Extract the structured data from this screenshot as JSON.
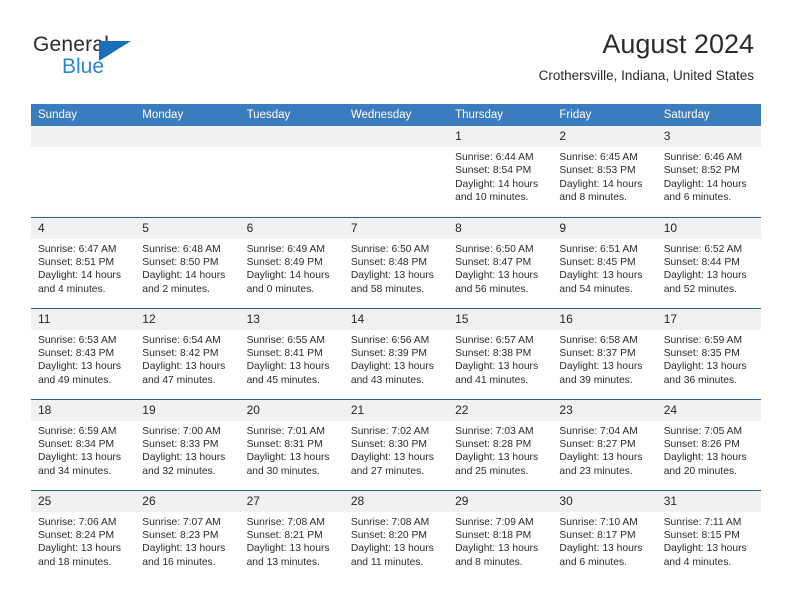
{
  "brand": {
    "name_line1": "General",
    "name_line2": "Blue",
    "triangle_color": "#1a70b8",
    "text_color": "#2b2b2b",
    "accent_color": "#2986cf"
  },
  "header": {
    "title": "August 2024",
    "location": "Crothersville, Indiana, United States"
  },
  "theme": {
    "header_bg": "#3b7cbe",
    "header_text": "#ffffff",
    "row_rule": "#2f5f93",
    "daynum_bg": "#f1f1f1",
    "body_text": "#2b2b2b"
  },
  "weekdays": [
    "Sunday",
    "Monday",
    "Tuesday",
    "Wednesday",
    "Thursday",
    "Friday",
    "Saturday"
  ],
  "labels": {
    "sunrise_prefix": "Sunrise:",
    "sunset_prefix": "Sunset:",
    "daylight_prefix": "Daylight:"
  },
  "weeks": [
    [
      {
        "day": "",
        "empty": true,
        "sunrise": "",
        "sunset": "",
        "daylight_line1": "",
        "daylight_line2": ""
      },
      {
        "day": "",
        "empty": true,
        "sunrise": "",
        "sunset": "",
        "daylight_line1": "",
        "daylight_line2": ""
      },
      {
        "day": "",
        "empty": true,
        "sunrise": "",
        "sunset": "",
        "daylight_line1": "",
        "daylight_line2": ""
      },
      {
        "day": "",
        "empty": true,
        "sunrise": "",
        "sunset": "",
        "daylight_line1": "",
        "daylight_line2": ""
      },
      {
        "day": "1",
        "empty": false,
        "sunrise": "Sunrise: 6:44 AM",
        "sunset": "Sunset: 8:54 PM",
        "daylight_line1": "Daylight: 14 hours",
        "daylight_line2": "and 10 minutes."
      },
      {
        "day": "2",
        "empty": false,
        "sunrise": "Sunrise: 6:45 AM",
        "sunset": "Sunset: 8:53 PM",
        "daylight_line1": "Daylight: 14 hours",
        "daylight_line2": "and 8 minutes."
      },
      {
        "day": "3",
        "empty": false,
        "sunrise": "Sunrise: 6:46 AM",
        "sunset": "Sunset: 8:52 PM",
        "daylight_line1": "Daylight: 14 hours",
        "daylight_line2": "and 6 minutes."
      }
    ],
    [
      {
        "day": "4",
        "empty": false,
        "sunrise": "Sunrise: 6:47 AM",
        "sunset": "Sunset: 8:51 PM",
        "daylight_line1": "Daylight: 14 hours",
        "daylight_line2": "and 4 minutes."
      },
      {
        "day": "5",
        "empty": false,
        "sunrise": "Sunrise: 6:48 AM",
        "sunset": "Sunset: 8:50 PM",
        "daylight_line1": "Daylight: 14 hours",
        "daylight_line2": "and 2 minutes."
      },
      {
        "day": "6",
        "empty": false,
        "sunrise": "Sunrise: 6:49 AM",
        "sunset": "Sunset: 8:49 PM",
        "daylight_line1": "Daylight: 14 hours",
        "daylight_line2": "and 0 minutes."
      },
      {
        "day": "7",
        "empty": false,
        "sunrise": "Sunrise: 6:50 AM",
        "sunset": "Sunset: 8:48 PM",
        "daylight_line1": "Daylight: 13 hours",
        "daylight_line2": "and 58 minutes."
      },
      {
        "day": "8",
        "empty": false,
        "sunrise": "Sunrise: 6:50 AM",
        "sunset": "Sunset: 8:47 PM",
        "daylight_line1": "Daylight: 13 hours",
        "daylight_line2": "and 56 minutes."
      },
      {
        "day": "9",
        "empty": false,
        "sunrise": "Sunrise: 6:51 AM",
        "sunset": "Sunset: 8:45 PM",
        "daylight_line1": "Daylight: 13 hours",
        "daylight_line2": "and 54 minutes."
      },
      {
        "day": "10",
        "empty": false,
        "sunrise": "Sunrise: 6:52 AM",
        "sunset": "Sunset: 8:44 PM",
        "daylight_line1": "Daylight: 13 hours",
        "daylight_line2": "and 52 minutes."
      }
    ],
    [
      {
        "day": "11",
        "empty": false,
        "sunrise": "Sunrise: 6:53 AM",
        "sunset": "Sunset: 8:43 PM",
        "daylight_line1": "Daylight: 13 hours",
        "daylight_line2": "and 49 minutes."
      },
      {
        "day": "12",
        "empty": false,
        "sunrise": "Sunrise: 6:54 AM",
        "sunset": "Sunset: 8:42 PM",
        "daylight_line1": "Daylight: 13 hours",
        "daylight_line2": "and 47 minutes."
      },
      {
        "day": "13",
        "empty": false,
        "sunrise": "Sunrise: 6:55 AM",
        "sunset": "Sunset: 8:41 PM",
        "daylight_line1": "Daylight: 13 hours",
        "daylight_line2": "and 45 minutes."
      },
      {
        "day": "14",
        "empty": false,
        "sunrise": "Sunrise: 6:56 AM",
        "sunset": "Sunset: 8:39 PM",
        "daylight_line1": "Daylight: 13 hours",
        "daylight_line2": "and 43 minutes."
      },
      {
        "day": "15",
        "empty": false,
        "sunrise": "Sunrise: 6:57 AM",
        "sunset": "Sunset: 8:38 PM",
        "daylight_line1": "Daylight: 13 hours",
        "daylight_line2": "and 41 minutes."
      },
      {
        "day": "16",
        "empty": false,
        "sunrise": "Sunrise: 6:58 AM",
        "sunset": "Sunset: 8:37 PM",
        "daylight_line1": "Daylight: 13 hours",
        "daylight_line2": "and 39 minutes."
      },
      {
        "day": "17",
        "empty": false,
        "sunrise": "Sunrise: 6:59 AM",
        "sunset": "Sunset: 8:35 PM",
        "daylight_line1": "Daylight: 13 hours",
        "daylight_line2": "and 36 minutes."
      }
    ],
    [
      {
        "day": "18",
        "empty": false,
        "sunrise": "Sunrise: 6:59 AM",
        "sunset": "Sunset: 8:34 PM",
        "daylight_line1": "Daylight: 13 hours",
        "daylight_line2": "and 34 minutes."
      },
      {
        "day": "19",
        "empty": false,
        "sunrise": "Sunrise: 7:00 AM",
        "sunset": "Sunset: 8:33 PM",
        "daylight_line1": "Daylight: 13 hours",
        "daylight_line2": "and 32 minutes."
      },
      {
        "day": "20",
        "empty": false,
        "sunrise": "Sunrise: 7:01 AM",
        "sunset": "Sunset: 8:31 PM",
        "daylight_line1": "Daylight: 13 hours",
        "daylight_line2": "and 30 minutes."
      },
      {
        "day": "21",
        "empty": false,
        "sunrise": "Sunrise: 7:02 AM",
        "sunset": "Sunset: 8:30 PM",
        "daylight_line1": "Daylight: 13 hours",
        "daylight_line2": "and 27 minutes."
      },
      {
        "day": "22",
        "empty": false,
        "sunrise": "Sunrise: 7:03 AM",
        "sunset": "Sunset: 8:28 PM",
        "daylight_line1": "Daylight: 13 hours",
        "daylight_line2": "and 25 minutes."
      },
      {
        "day": "23",
        "empty": false,
        "sunrise": "Sunrise: 7:04 AM",
        "sunset": "Sunset: 8:27 PM",
        "daylight_line1": "Daylight: 13 hours",
        "daylight_line2": "and 23 minutes."
      },
      {
        "day": "24",
        "empty": false,
        "sunrise": "Sunrise: 7:05 AM",
        "sunset": "Sunset: 8:26 PM",
        "daylight_line1": "Daylight: 13 hours",
        "daylight_line2": "and 20 minutes."
      }
    ],
    [
      {
        "day": "25",
        "empty": false,
        "sunrise": "Sunrise: 7:06 AM",
        "sunset": "Sunset: 8:24 PM",
        "daylight_line1": "Daylight: 13 hours",
        "daylight_line2": "and 18 minutes."
      },
      {
        "day": "26",
        "empty": false,
        "sunrise": "Sunrise: 7:07 AM",
        "sunset": "Sunset: 8:23 PM",
        "daylight_line1": "Daylight: 13 hours",
        "daylight_line2": "and 16 minutes."
      },
      {
        "day": "27",
        "empty": false,
        "sunrise": "Sunrise: 7:08 AM",
        "sunset": "Sunset: 8:21 PM",
        "daylight_line1": "Daylight: 13 hours",
        "daylight_line2": "and 13 minutes."
      },
      {
        "day": "28",
        "empty": false,
        "sunrise": "Sunrise: 7:08 AM",
        "sunset": "Sunset: 8:20 PM",
        "daylight_line1": "Daylight: 13 hours",
        "daylight_line2": "and 11 minutes."
      },
      {
        "day": "29",
        "empty": false,
        "sunrise": "Sunrise: 7:09 AM",
        "sunset": "Sunset: 8:18 PM",
        "daylight_line1": "Daylight: 13 hours",
        "daylight_line2": "and 8 minutes."
      },
      {
        "day": "30",
        "empty": false,
        "sunrise": "Sunrise: 7:10 AM",
        "sunset": "Sunset: 8:17 PM",
        "daylight_line1": "Daylight: 13 hours",
        "daylight_line2": "and 6 minutes."
      },
      {
        "day": "31",
        "empty": false,
        "sunrise": "Sunrise: 7:11 AM",
        "sunset": "Sunset: 8:15 PM",
        "daylight_line1": "Daylight: 13 hours",
        "daylight_line2": "and 4 minutes."
      }
    ]
  ]
}
